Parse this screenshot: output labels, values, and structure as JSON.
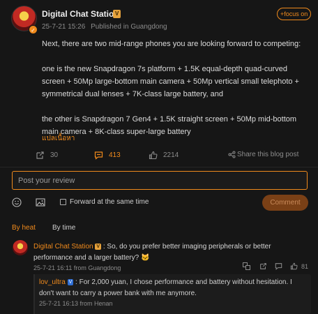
{
  "post": {
    "author": "Digital Chat Station",
    "level_badge": "V",
    "author_badge_icon": "check-badge-icon",
    "date": "25-7-21 15:26",
    "source": "Published in Guangdong",
    "follow_label": "+focus on",
    "paragraphs": [
      "Next, there are two mid-range phones you are looking forward to competing:",
      "one is the new Snapdragon 7s platform + 1.5K equal-depth quad-curved screen + 50Mp large-bottom main camera + 50Mp vertical small telephoto + symmetrical dual lenses + 7K-class large battery, and",
      "the other is Snapdragon 7 Gen4 + 1.5K straight screen + 50Mp mid-bottom main camera + 8K-class super-large battery"
    ],
    "translate_label": "แปลเนื้อหา",
    "reposts": "30",
    "comments": "413",
    "likes": "2214",
    "share_label": "Share this blog post"
  },
  "composer": {
    "placeholder": "Post your review",
    "forward_label": "Forward at the same time",
    "comment_button": "Comment"
  },
  "sort_tabs": {
    "heat": "By heat",
    "time": "By time"
  },
  "comment": {
    "author": "Digital Chat Station",
    "tag": "V",
    "text": " : So, do you prefer better imaging peripherals or better performance and a larger battery?",
    "emoji": "🐱",
    "date": "25-7-21 16:11 from Guangdong",
    "likes": "81"
  },
  "reply": {
    "author": "lov_ultra",
    "tag": "V",
    "text": " : For 2,000 yuan, I chose performance and battery without hesitation. I don't want to carry a power bank with me anymore.",
    "date": "25-7-21 16:13 from Henan"
  },
  "colors": {
    "accent": "#f08a1c",
    "background": "#161616"
  }
}
